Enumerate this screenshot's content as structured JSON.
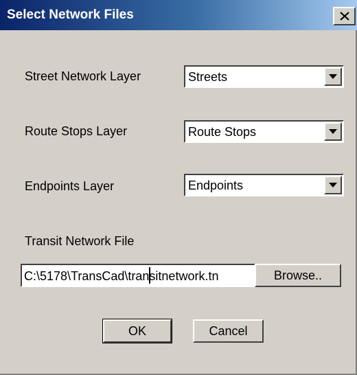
{
  "window": {
    "title": "Select Network Files",
    "close_icon": "close-icon"
  },
  "form": {
    "street_network": {
      "label": "Street Network Layer",
      "value": "Streets"
    },
    "route_stops": {
      "label": "Route Stops Layer",
      "value": "Route Stops"
    },
    "endpoints": {
      "label": "Endpoints Layer",
      "value": "Endpoints"
    },
    "transit_network_file": {
      "label": "Transit Network File",
      "value": "C:\\5178\\TransCad\\transitnetwork.tn"
    }
  },
  "buttons": {
    "browse": "Browse..",
    "ok": "OK",
    "cancel": "Cancel"
  },
  "colors": {
    "titlebar_start": "#0a246a",
    "titlebar_end": "#a6caf0",
    "dialog_face": "#d4d0c8"
  }
}
